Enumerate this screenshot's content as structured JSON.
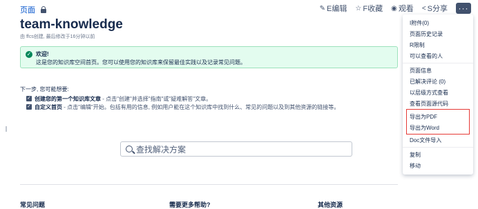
{
  "breadcrumb": {
    "pages_label": "页面"
  },
  "toolbar": {
    "edit_icon": "pencil-icon",
    "edit_label": "E编辑",
    "favorite_icon": "star-icon",
    "favorite_label": "F收藏",
    "watch_icon": "eye-icon",
    "watch_label": "观看",
    "share_icon": "share-icon",
    "share_label": "S分享",
    "more_label": "···"
  },
  "page": {
    "title": "team-knowledge",
    "meta": "由 ffcs创建, 最后修改于16分钟以前"
  },
  "welcome": {
    "title": "欢迎!",
    "desc": "这是您的知识库空间首页。您可以使用您的知识库来保留最佳实践以及记录常见问题。"
  },
  "next": {
    "heading": "下一步, 您可能想要:",
    "tasks": [
      {
        "bold": "创建您的第一个知识库文章",
        "text": " - 点击\"创建\"并选择\"指南\"或\"疑难解答\"文章。"
      },
      {
        "bold": "自定义首页",
        "text": " - 点击\"编辑\"开始。包括有用的信息, 例如用户能在这个知识库中找到什么、常见的问题以及到其他资源的链接等。"
      }
    ]
  },
  "search": {
    "placeholder": "查找解决方案"
  },
  "footer": {
    "col1": "常见问题",
    "col2": "需要更多帮助?",
    "col3": "其他资源"
  },
  "menu": {
    "items": [
      "I附件(0)",
      "页面历史记录",
      "R限制",
      "可以查看的人",
      "页面信息",
      "已解决评论 (0)",
      "以层级方式查看",
      "查看页面源代码",
      "导出为PDF",
      "导出为Word",
      "Doc文件导入",
      "复制",
      "移动"
    ]
  },
  "colors": {
    "accent": "#0052cc",
    "highlight_border": "#e53935",
    "success_bg": "#e3fcef"
  }
}
